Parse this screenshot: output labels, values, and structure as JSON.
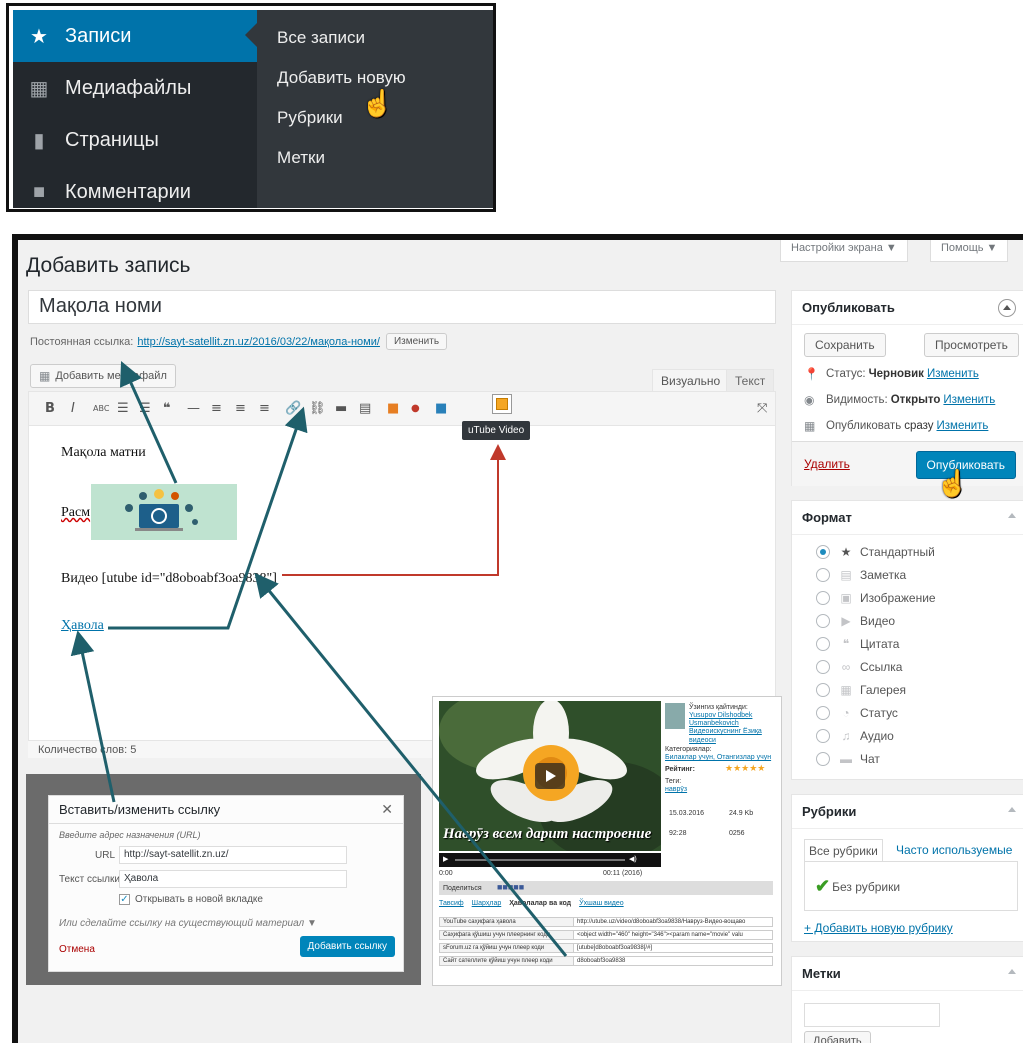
{
  "admin_menu": {
    "items": [
      {
        "label": "Записи",
        "icon": "pushpin-icon",
        "active": true
      },
      {
        "label": "Медиафайлы",
        "icon": "media-icon"
      },
      {
        "label": "Страницы",
        "icon": "pages-icon"
      },
      {
        "label": "Комментарии",
        "icon": "comments-icon"
      }
    ],
    "submenu": [
      "Все записи",
      "Добавить новую",
      "Рубрики",
      "Метки"
    ]
  },
  "header": {
    "screen_options": "Настройки экрана ▼",
    "help": "Помощь ▼",
    "page_title": "Добавить запись"
  },
  "post": {
    "title": "Мақола номи",
    "permalink_label": "Постоянная ссылка:",
    "permalink_url": "http://sayt-satellit.zn.uz/2016/03/22/мақола-номи/",
    "permalink_edit": "Изменить",
    "add_media": "Добавить медиафайл",
    "tab_visual": "Визуально",
    "tab_text": "Текст",
    "tooltip": "uTube Video",
    "content": {
      "line1": "Мақола матни",
      "image_label": "Расм",
      "video_shortcode": "Видео [utube id=\"d8obоabf3oa9838\"]",
      "link_text": "Ҳавола"
    },
    "word_count": "Количество слов: 5"
  },
  "link_dialog": {
    "title": "Вставить/изменить ссылку",
    "hint": "Введите адрес назначения (URL)",
    "url_label": "URL",
    "url_value": "http://sayt-satellit.zn.uz/",
    "text_label": "Текст ссылки",
    "text_value": "Ҳавола",
    "new_tab_label": "Открывать в новой вкладке",
    "new_tab_checked": true,
    "existing_link": "Или сделайте ссылку на существующий материал ▼",
    "cancel": "Отмена",
    "submit": "Добавить ссылку"
  },
  "video_page": {
    "caption": "Наврӯз всем дарит настроение",
    "time_left": "0:00",
    "time_right": "00:11 (2016)",
    "author_label": "Ўзингиз қайтинди:",
    "author_links": [
      "Yusupov Dilshodbek",
      "Usmanbekovich",
      "Видеоискуснинг Ёзиқа видеоси"
    ],
    "categories_label": "Категориялар:",
    "categories_value": "Билаклар учун, Отангизлар учун",
    "rating_label": "Рейтинг:",
    "tags_label": "Теги:",
    "tags_value": "наврӯз",
    "date": "15.03.2016",
    "likes": "24.9 Kb",
    "views": "92:28",
    "counter": "0256",
    "share_label": "Поделиться",
    "tabs": [
      "Тавсиф",
      "Шарҳлар",
      "Ҳаволалар ва код",
      "Ўхшаш видео"
    ],
    "rows": [
      {
        "label": "YouTube саҳифага ҳавола",
        "value": "http://utube.uz/video/d8obоabf3oa9838/Навруз-Видео-вощаво"
      },
      {
        "label": "Саҳифага қўшиш учун плеернинг коди",
        "value": "<object width=\"460\" height=\"346\"><param name=\"movie\" valu"
      },
      {
        "label": "sForum.uz га қўйиш учун плеер коди",
        "value": "[utube]d8obоabf3oa9838[/#]"
      },
      {
        "label": "Сайт сателлите қўйиш учун плеер коди",
        "value": "d8obоabf3oa9838"
      }
    ]
  },
  "publish_box": {
    "title": "Опубликовать",
    "save": "Сохранить",
    "preview": "Просмотреть",
    "status_label": "Статус:",
    "status_value": "Черновик",
    "visibility_label": "Видимость:",
    "visibility_value": "Открыто",
    "publish_label": "Опубликовать",
    "publish_value": "сразу",
    "edit": "Изменить",
    "delete": "Удалить",
    "publish_button": "Опубликовать"
  },
  "format_box": {
    "title": "Формат",
    "options": [
      {
        "label": "Стандартный",
        "icon": "pushpin-icon",
        "selected": true
      },
      {
        "label": "Заметка",
        "icon": "aside-icon"
      },
      {
        "label": "Изображение",
        "icon": "image-icon"
      },
      {
        "label": "Видео",
        "icon": "video-icon"
      },
      {
        "label": "Цитата",
        "icon": "quote-icon"
      },
      {
        "label": "Ссылка",
        "icon": "link-icon"
      },
      {
        "label": "Галерея",
        "icon": "gallery-icon"
      },
      {
        "label": "Статус",
        "icon": "status-icon"
      },
      {
        "label": "Аудио",
        "icon": "audio-icon"
      },
      {
        "label": "Чат",
        "icon": "chat-icon"
      }
    ]
  },
  "categories_box": {
    "title": "Рубрики",
    "tab_all": "Все рубрики",
    "tab_popular": "Часто используемые",
    "item": "Без рубрики",
    "item_checked": true,
    "add_new": "+ Добавить новую рубрику"
  },
  "tags_box": {
    "title": "Метки",
    "input_value": "",
    "add_button": "Добавить"
  },
  "colors": {
    "wp_blue": "#0073aa",
    "admin_dark": "#23282d",
    "arrow_teal": "#1f5f6b",
    "arrow_red": "#c0392b"
  }
}
